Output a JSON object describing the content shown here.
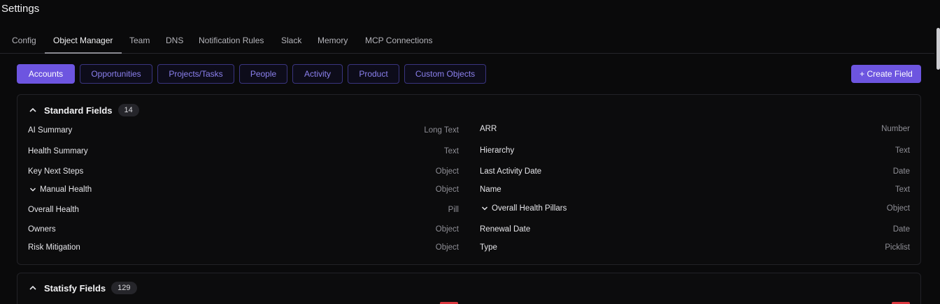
{
  "page": {
    "title": "Settings"
  },
  "tabs": [
    {
      "label": "Config"
    },
    {
      "label": "Object Manager",
      "active": true
    },
    {
      "label": "Team"
    },
    {
      "label": "DNS"
    },
    {
      "label": "Notification Rules"
    },
    {
      "label": "Slack"
    },
    {
      "label": "Memory"
    },
    {
      "label": "MCP Connections"
    }
  ],
  "objects": [
    {
      "label": "Accounts",
      "active": true
    },
    {
      "label": "Opportunities"
    },
    {
      "label": "Projects/Tasks"
    },
    {
      "label": "People"
    },
    {
      "label": "Activity"
    },
    {
      "label": "Product"
    },
    {
      "label": "Custom Objects"
    }
  ],
  "create_field_label": "+ Create Field",
  "standard": {
    "title": "Standard Fields",
    "count": "14",
    "left": [
      {
        "name": "AI Summary",
        "type": "Long Text"
      },
      {
        "name": "Health Summary",
        "type": "Text"
      },
      {
        "name": "Key Next Steps",
        "type": "Object"
      },
      {
        "name": "Manual Health",
        "type": "Object",
        "expandable": true
      },
      {
        "name": "Overall Health",
        "type": "Pill"
      },
      {
        "name": "Owners",
        "type": "Object"
      },
      {
        "name": "Risk Mitigation",
        "type": "Object"
      }
    ],
    "right": [
      {
        "name": "ARR",
        "type": "Number"
      },
      {
        "name": "Hierarchy",
        "type": "Text"
      },
      {
        "name": "Last Activity Date",
        "type": "Date"
      },
      {
        "name": "Name",
        "type": "Text"
      },
      {
        "name": "Overall Health Pillars",
        "type": "Object",
        "expandable": true
      },
      {
        "name": "Renewal Date",
        "type": "Date"
      },
      {
        "name": "Type",
        "type": "Picklist"
      }
    ]
  },
  "statisfy": {
    "title": "Statisfy Fields",
    "count": "129"
  },
  "colors": {
    "accent": "#6d55e0",
    "background": "#0a0a0b",
    "badge_red": "#d9373e"
  }
}
